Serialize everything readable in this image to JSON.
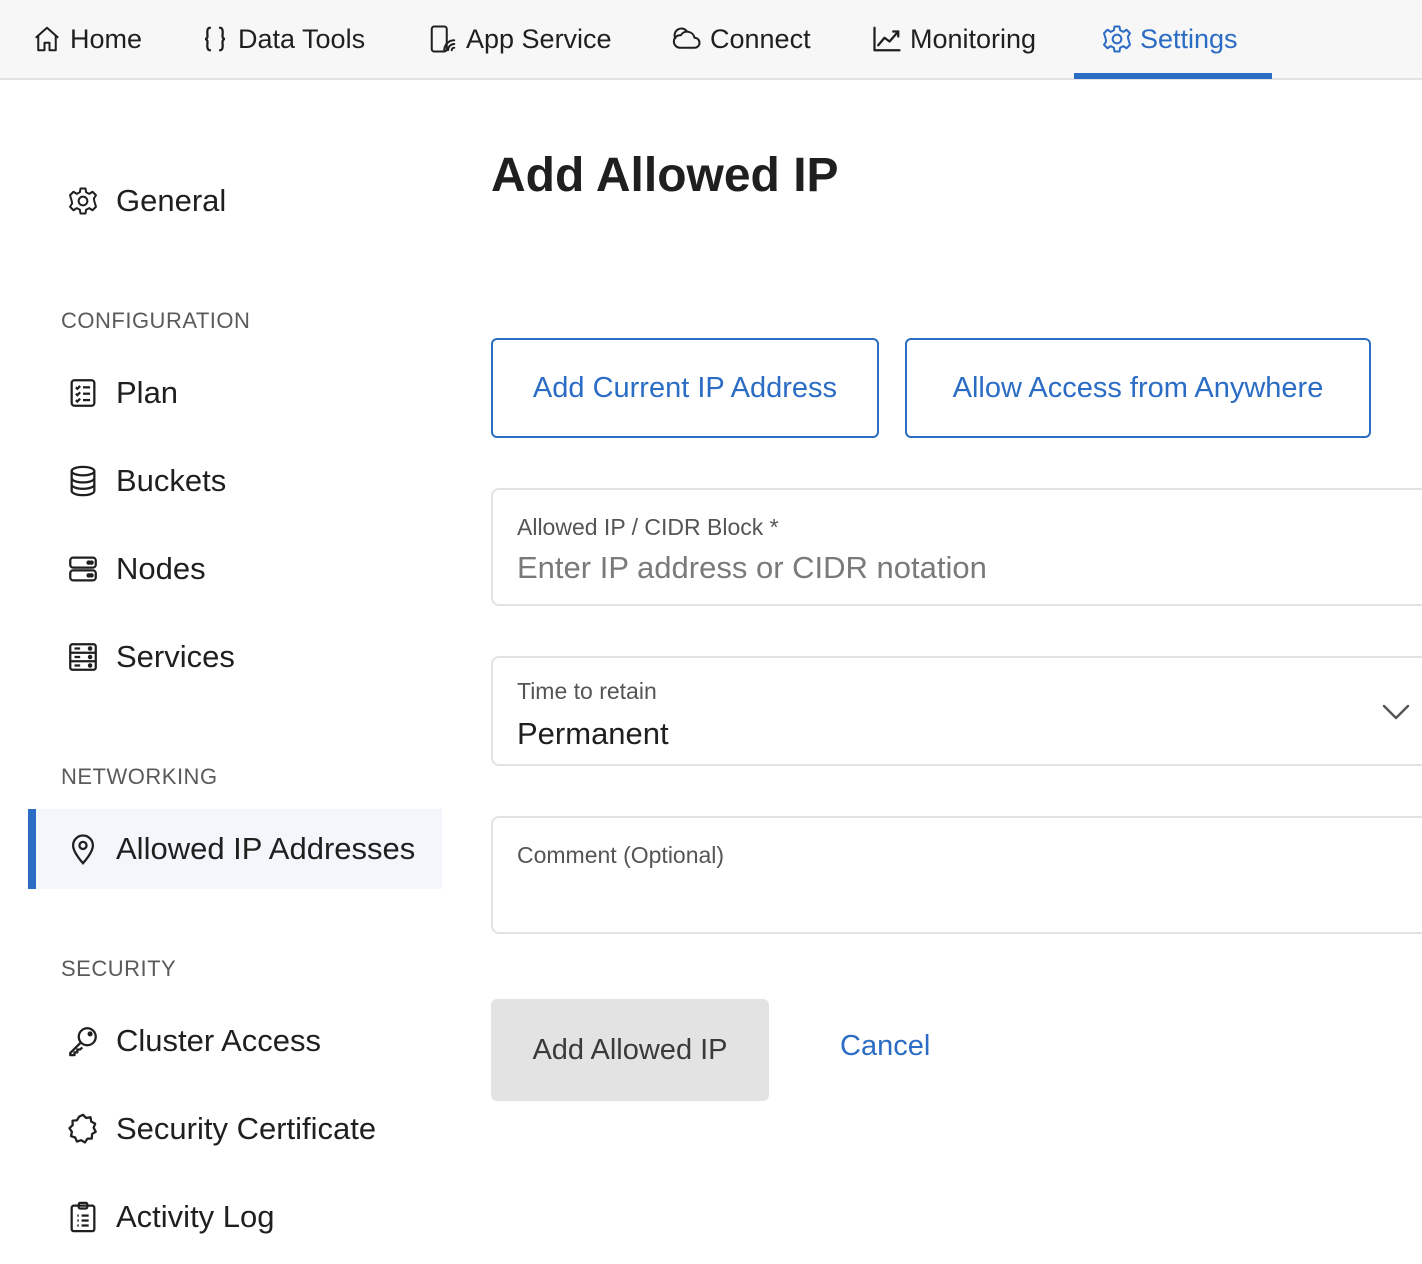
{
  "nav": {
    "tabs": [
      {
        "label": "Home",
        "icon": "home-icon"
      },
      {
        "label": "Data Tools",
        "icon": "braces-icon"
      },
      {
        "label": "App Service",
        "icon": "app-service-icon"
      },
      {
        "label": "Connect",
        "icon": "cloud-icon"
      },
      {
        "label": "Monitoring",
        "icon": "chart-line-icon"
      },
      {
        "label": "Settings",
        "icon": "gear-icon",
        "active": true
      }
    ]
  },
  "sidebar": {
    "general": {
      "label": "General",
      "icon": "gear-icon"
    },
    "sections": [
      {
        "header": "CONFIGURATION",
        "items": [
          {
            "label": "Plan",
            "icon": "checklist-icon"
          },
          {
            "label": "Buckets",
            "icon": "database-icon"
          },
          {
            "label": "Nodes",
            "icon": "server-icon"
          },
          {
            "label": "Services",
            "icon": "services-icon"
          }
        ]
      },
      {
        "header": "NETWORKING",
        "items": [
          {
            "label": "Allowed IP Addresses",
            "icon": "location-pin-icon",
            "active": true
          }
        ]
      },
      {
        "header": "SECURITY",
        "items": [
          {
            "label": "Cluster Access",
            "icon": "key-icon"
          },
          {
            "label": "Security Certificate",
            "icon": "certificate-icon"
          },
          {
            "label": "Activity Log",
            "icon": "clipboard-icon"
          }
        ]
      }
    ]
  },
  "main": {
    "title": "Add Allowed IP",
    "quick_actions": {
      "add_current": "Add Current IP Address",
      "allow_anywhere": "Allow Access from Anywhere"
    },
    "form": {
      "ip": {
        "label": "Allowed IP / CIDR Block *",
        "placeholder": "Enter IP address or CIDR notation",
        "value": ""
      },
      "retain": {
        "label": "Time to retain",
        "value": "Permanent"
      },
      "comment": {
        "label": "Comment (Optional)",
        "value": ""
      }
    },
    "submit_label": "Add Allowed IP",
    "cancel_label": "Cancel"
  },
  "colors": {
    "accent": "#2b6cc4",
    "active_bg": "#f3f6fb",
    "disabled_btn": "#e3e3e3"
  }
}
